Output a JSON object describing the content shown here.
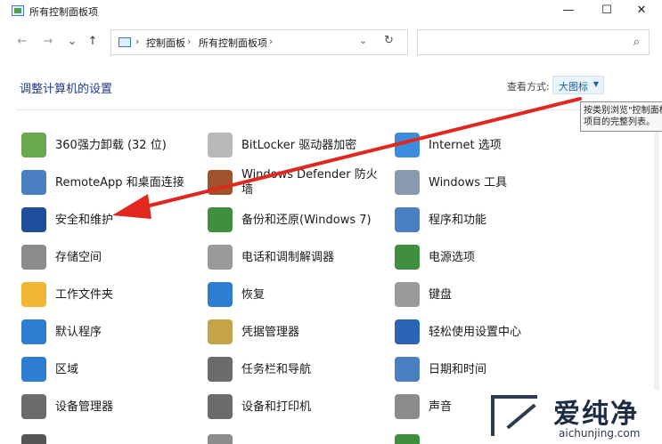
{
  "window": {
    "title": "所有控制面板项",
    "minimize_label": "—",
    "maximize_label": "☐",
    "close_label": "✕"
  },
  "nav": {
    "back": "←",
    "forward": "→",
    "recent": "⌄",
    "up": "↑",
    "breadcrumb": [
      "控制面板",
      "所有控制面板项"
    ],
    "separator": "›",
    "dropdown": "⌄",
    "refresh": "↻",
    "search_placeholder": "",
    "search_icon": "⌕"
  },
  "header": {
    "title": "调整计算机的设置",
    "view_label": "查看方式:",
    "view_value": "大图标",
    "view_caret": "▼"
  },
  "tooltip": {
    "line1": "按类别浏览\"控制面板",
    "line2": "项目的完整列表。"
  },
  "items": [
    {
      "label": "360强力卸载 (32 位)",
      "icon": "uninstall-icon",
      "color": "#6aa84f"
    },
    {
      "label": "BitLocker 驱动器加密",
      "icon": "key-icon",
      "color": "#b9b9b9"
    },
    {
      "label": "Internet 选项",
      "icon": "internet-icon",
      "color": "#3c8dde"
    },
    {
      "label": "RemoteApp 和桌面连接",
      "icon": "remote-desktop-icon",
      "color": "#4a7fc1"
    },
    {
      "label": "Windows Defender 防火墙",
      "icon": "firewall-icon",
      "color": "#a0522d"
    },
    {
      "label": "Windows 工具",
      "icon": "tools-icon",
      "color": "#8a99ad"
    },
    {
      "label": "安全和维护",
      "icon": "flag-icon",
      "color": "#1f4e9c"
    },
    {
      "label": "备份和还原(Windows 7)",
      "icon": "backup-icon",
      "color": "#3f8f3f"
    },
    {
      "label": "程序和功能",
      "icon": "programs-icon",
      "color": "#4a7fc1"
    },
    {
      "label": "存储空间",
      "icon": "storage-icon",
      "color": "#8c8c8c"
    },
    {
      "label": "电话和调制解调器",
      "icon": "phone-icon",
      "color": "#9a9a9a"
    },
    {
      "label": "电源选项",
      "icon": "power-icon",
      "color": "#3f8f3f"
    },
    {
      "label": "工作文件夹",
      "icon": "folder-icon",
      "color": "#f2b632"
    },
    {
      "label": "恢复",
      "icon": "recovery-icon",
      "color": "#2d7dd2"
    },
    {
      "label": "键盘",
      "icon": "keyboard-icon",
      "color": "#9a9a9a"
    },
    {
      "label": "默认程序",
      "icon": "default-programs-icon",
      "color": "#2d7dd2"
    },
    {
      "label": "凭据管理器",
      "icon": "credential-icon",
      "color": "#c7a348"
    },
    {
      "label": "轻松使用设置中心",
      "icon": "accessibility-icon",
      "color": "#2d63b5"
    },
    {
      "label": "区域",
      "icon": "globe-icon",
      "color": "#2d7dd2"
    },
    {
      "label": "任务栏和导航",
      "icon": "taskbar-icon",
      "color": "#6b6b6b"
    },
    {
      "label": "日期和时间",
      "icon": "calendar-icon",
      "color": "#4a7fc1"
    },
    {
      "label": "设备管理器",
      "icon": "device-manager-icon",
      "color": "#6b6b6b"
    },
    {
      "label": "设备和打印机",
      "icon": "printer-icon",
      "color": "#6b6b6b"
    },
    {
      "label": "声音",
      "icon": "speaker-icon",
      "color": "#8c8c8c"
    }
  ],
  "partial_icons": {
    "colors": [
      "#555555",
      "#8c8c8c",
      "#3f8f3f"
    ]
  },
  "watermark": {
    "brand": "爱纯净",
    "url": "aichunjing.com"
  },
  "annotation": {
    "arrow_color": "#e0281e"
  }
}
